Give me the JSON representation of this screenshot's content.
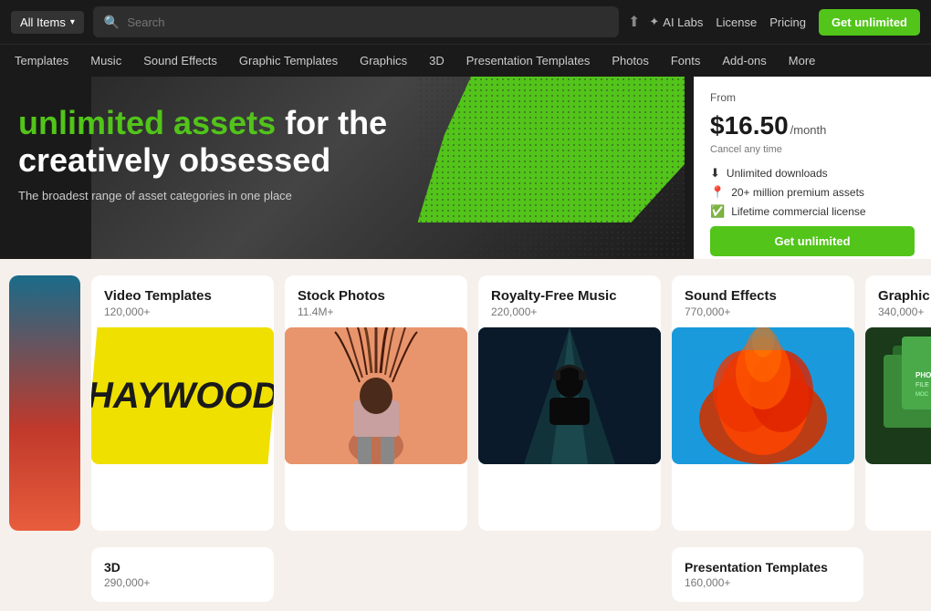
{
  "topbar": {
    "all_items_label": "All Items",
    "search_placeholder": "Search",
    "ai_labs_label": "AI Labs",
    "license_label": "License",
    "pricing_label": "Pricing",
    "get_unlimited_label": "Get unlimited"
  },
  "subnav": {
    "items": [
      {
        "label": "Templates"
      },
      {
        "label": "Music"
      },
      {
        "label": "Sound Effects"
      },
      {
        "label": "Graphic Templates"
      },
      {
        "label": "Graphics"
      },
      {
        "label": "3D"
      },
      {
        "label": "Presentation Templates"
      },
      {
        "label": "Photos"
      },
      {
        "label": "Fonts"
      },
      {
        "label": "Add-ons"
      },
      {
        "label": "More"
      }
    ]
  },
  "hero": {
    "title_part1": "unlimited assets",
    "title_part2": " for the",
    "title_line2": "creatively obsessed",
    "subtitle": "The broadest range of asset categories in one place"
  },
  "pricing": {
    "from_label": "From",
    "price": "$16.50",
    "period": "/month",
    "cancel_text": "Cancel any time",
    "features": [
      {
        "icon": "⬇",
        "text": "Unlimited downloads"
      },
      {
        "icon": "📍",
        "text": "20+ million premium assets"
      },
      {
        "icon": "✅",
        "text": "Lifetime commercial license"
      }
    ],
    "cta_label": "Get unlimited"
  },
  "cards": [
    {
      "title": "Video Templates",
      "count": "120,000+",
      "type": "video"
    },
    {
      "title": "Stock Photos",
      "count": "11.4M+",
      "type": "photos"
    },
    {
      "title": "Royalty-Free Music",
      "count": "220,000+",
      "type": "music"
    },
    {
      "title": "Sound Effects",
      "count": "770,000+",
      "type": "sound"
    },
    {
      "title": "Graphic Templates",
      "count": "340,000+",
      "type": "graphic"
    }
  ],
  "bottom_cards": [
    {
      "title": "3D",
      "count": "290,000+"
    },
    {
      "title": "Presentation Templates",
      "count": "160,000+"
    }
  ]
}
